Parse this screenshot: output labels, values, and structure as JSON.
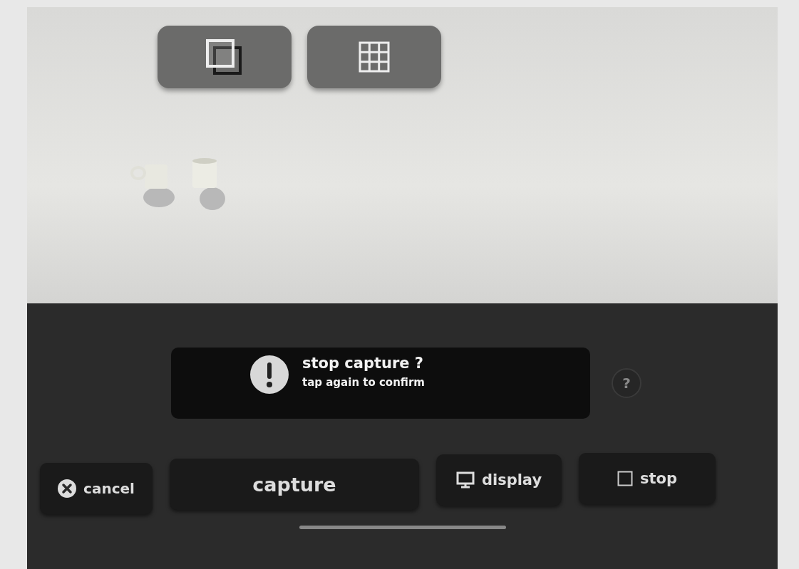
{
  "dialog": {
    "title": "stop capture ?",
    "message": "tap again to confirm"
  },
  "help_button": {
    "label": "?"
  },
  "bottom_buttons": [
    {
      "kind": "cancel",
      "label": "cancel"
    },
    {
      "kind": "plain",
      "label": "capture"
    },
    {
      "kind": "display",
      "label": "display"
    },
    {
      "kind": "stop",
      "label": "stop"
    }
  ]
}
